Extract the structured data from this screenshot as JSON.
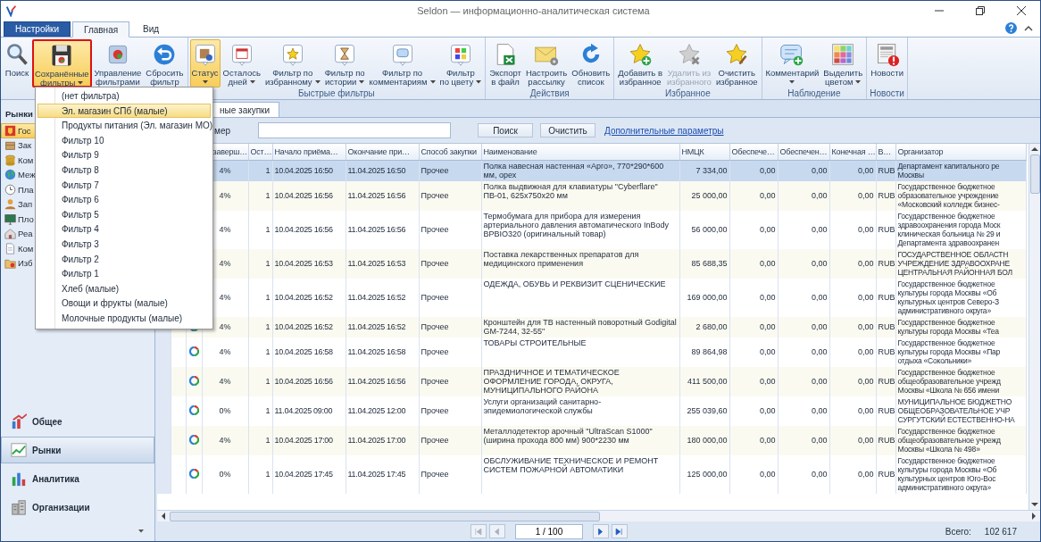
{
  "window": {
    "title": "Seldon — информационно-аналитическая система"
  },
  "ribbon_tabs": [
    {
      "label": "Настройки",
      "kind": "app",
      "selected": false
    },
    {
      "label": "Главная",
      "kind": "tab",
      "selected": true
    },
    {
      "label": "Вид",
      "kind": "tab",
      "selected": false
    }
  ],
  "ribbon_groups": [
    {
      "buttons": [
        {
          "label": "Поиск",
          "dropdown": false,
          "open": false,
          "pressed": false,
          "disabled": false
        },
        {
          "label": "Сохранённые\nфильтры",
          "dropdown": true,
          "open": true,
          "pressed": false,
          "disabled": false
        },
        {
          "label": "Управление\nфильтрами",
          "dropdown": false,
          "open": false,
          "pressed": false,
          "disabled": false
        },
        {
          "label": "Сбросить\nфильтр",
          "dropdown": false,
          "open": false,
          "pressed": false,
          "disabled": false
        }
      ]
    },
    {
      "label": "Быстрые фильтры",
      "buttons": [
        {
          "label": "Статус",
          "dropdown": true,
          "open": false,
          "pressed": true,
          "disabled": false
        },
        {
          "label": "Осталось\nдней",
          "dropdown": true,
          "open": false,
          "pressed": false,
          "disabled": false
        },
        {
          "label": "Фильтр по\nизбранному",
          "dropdown": true,
          "open": false,
          "pressed": false,
          "disabled": false
        },
        {
          "label": "Фильтр по\nистории",
          "dropdown": true,
          "open": false,
          "pressed": false,
          "disabled": false
        },
        {
          "label": "Фильтр по\nкомментариям",
          "dropdown": true,
          "open": false,
          "pressed": false,
          "disabled": false
        },
        {
          "label": "Фильтр\nпо цвету",
          "dropdown": true,
          "open": false,
          "pressed": false,
          "disabled": false
        }
      ]
    },
    {
      "label": "Действия",
      "buttons": [
        {
          "label": "Экспорт\nв файл",
          "dropdown": false,
          "open": false,
          "pressed": false,
          "disabled": false
        },
        {
          "label": "Настроить\nрассылку",
          "dropdown": false,
          "open": false,
          "pressed": false,
          "disabled": false
        },
        {
          "label": "Обновить\nсписок",
          "dropdown": false,
          "open": false,
          "pressed": false,
          "disabled": false
        }
      ]
    },
    {
      "label": "Избранное",
      "buttons": [
        {
          "label": "Добавить в\nизбранное",
          "dropdown": false,
          "open": false,
          "pressed": false,
          "disabled": false
        },
        {
          "label": "Удалить из\nизбранного",
          "dropdown": false,
          "open": false,
          "pressed": false,
          "disabled": true
        },
        {
          "label": "Очистить\nизбранное",
          "dropdown": false,
          "open": false,
          "pressed": false,
          "disabled": false
        }
      ]
    },
    {
      "label": "Наблюдение",
      "buttons": [
        {
          "label": "Комментарий",
          "dropdown": true,
          "open": false,
          "pressed": false,
          "disabled": false
        },
        {
          "label": "Выделить\nцветом",
          "dropdown": true,
          "open": false,
          "pressed": false,
          "disabled": false
        }
      ]
    },
    {
      "label": "Новости",
      "buttons": [
        {
          "label": "Новости",
          "dropdown": false,
          "open": false,
          "pressed": false,
          "disabled": false
        }
      ]
    }
  ],
  "saved_filters_menu": {
    "items": [
      {
        "label": "(нет фильтра)",
        "selected": false
      },
      {
        "label": "Эл. магазин СПб (малые)",
        "selected": true
      },
      {
        "label": "Продукты питания (Эл. магазин МО)",
        "selected": false
      },
      {
        "label": "Фильтр 10",
        "selected": false
      },
      {
        "label": "Фильтр 9",
        "selected": false
      },
      {
        "label": "Фильтр 8",
        "selected": false
      },
      {
        "label": "Фильтр 7",
        "selected": false
      },
      {
        "label": "Фильтр 6",
        "selected": false
      },
      {
        "label": "Фильтр 5",
        "selected": false
      },
      {
        "label": "Фильтр 4",
        "selected": false
      },
      {
        "label": "Фильтр 3",
        "selected": false
      },
      {
        "label": "Фильтр 2",
        "selected": false
      },
      {
        "label": "Фильтр 1",
        "selected": false
      },
      {
        "label": "Хлеб (малые)",
        "selected": false
      },
      {
        "label": "Овощи и фрукты (малые)",
        "selected": false
      },
      {
        "label": "Молочные продукты (малые)",
        "selected": false
      }
    ]
  },
  "sidebar": {
    "title": "Рынки",
    "items": [
      {
        "label": "Гос",
        "selected": true
      },
      {
        "label": "Зак",
        "selected": false
      },
      {
        "label": "Ком",
        "selected": false
      },
      {
        "label": "Меж",
        "selected": false
      },
      {
        "label": "Пла",
        "selected": false
      },
      {
        "label": "Зап",
        "selected": false
      },
      {
        "label": "Пло",
        "selected": false
      },
      {
        "label": "Реа",
        "selected": false
      },
      {
        "label": "Ком",
        "selected": false
      },
      {
        "label": "Изб",
        "selected": false
      }
    ],
    "nav": [
      {
        "label": "Общее",
        "selected": false
      },
      {
        "label": "Рынки",
        "selected": true
      },
      {
        "label": "Аналитика",
        "selected": false
      },
      {
        "label": "Организации",
        "selected": false
      }
    ]
  },
  "doc_tabs": [
    {
      "label": "ные закупки",
      "selected": true
    }
  ],
  "search": {
    "label": "мер",
    "buttons": [
      "Поиск",
      "Очистить"
    ],
    "link": "Дополнительные параметры"
  },
  "table": {
    "columns": [
      "заверш…",
      "Ост…",
      "Начало приёма…",
      "Окончание при…",
      "Способ закупки",
      "Наименование",
      "НМЦК",
      "Обеспече…",
      "Обеспечен…",
      "Конечная …",
      "В…",
      "Организатор"
    ],
    "rows": [
      {
        "selected": true,
        "cells": [
          "4%",
          "1",
          "10.04.2025 16:50",
          "11.04.2025 16:50",
          "Прочее",
          "Полка навесная настенная «Арго», 770*290*600 мм, орех",
          "7 334,00",
          "0,00",
          "0,00",
          "0,00",
          "RUB",
          "Департамент капитального ре\nМосквы"
        ]
      },
      {
        "selected": false,
        "cells": [
          "4%",
          "1",
          "10.04.2025 16:56",
          "11.04.2025 16:56",
          "Прочее",
          "Полка выдвижная для клавиатуры \"Cyberflare\" ПВ-01, 625x750x20 мм",
          "25 000,00",
          "0,00",
          "0,00",
          "0,00",
          "RUB",
          "Государственное бюджетное\nобразовательное учреждение\n«Московский колледж бизнес-"
        ]
      },
      {
        "selected": false,
        "cells": [
          "4%",
          "1",
          "10.04.2025 16:56",
          "11.04.2025 16:56",
          "Прочее",
          "Термобумага для прибора для измерения артериального давления автоматического InBody BPBIO320 (оригинальный товар)",
          "56 000,00",
          "0,00",
          "0,00",
          "0,00",
          "RUB",
          "Государственное бюджетное\nздравоохранения города Моск\nклиническая больница № 29 и\nДепартамента здравоохранен"
        ]
      },
      {
        "selected": false,
        "cells": [
          "4%",
          "1",
          "10.04.2025 16:53",
          "11.04.2025 16:53",
          "Прочее",
          "Поставка лекарственных препаратов для медицинского применения",
          "85 688,35",
          "0,00",
          "0,00",
          "0,00",
          "RUB",
          "ГОСУДАРСТВЕННОЕ ОБЛАСТН\nУЧРЕЖДЕНИЕ ЗДРАВООХРАНЕ\nЦЕНТРАЛЬНАЯ РАЙОННАЯ БОЛ"
        ]
      },
      {
        "selected": false,
        "cells": [
          "4%",
          "1",
          "10.04.2025 16:52",
          "11.04.2025 16:52",
          "Прочее",
          "ОДЕЖДА, ОБУВЬ И РЕКВИЗИТ СЦЕНИЧЕСКИЕ",
          "169 000,00",
          "0,00",
          "0,00",
          "0,00",
          "RUB",
          "Государственное бюджетное\nкультуры города Москвы «Об\nкультурных центров Северо-З\nадминистративного округа»"
        ]
      },
      {
        "selected": false,
        "icon": true,
        "cells": [
          "4%",
          "1",
          "10.04.2025 16:52",
          "11.04.2025 16:52",
          "Прочее",
          "Кронштейн для ТВ настенный поворотный Godigital GM-7244, 32-55\"",
          "2 680,00",
          "0,00",
          "0,00",
          "0,00",
          "RUB",
          "Государственное бюджетное\nкультуры города Москвы «Теа"
        ]
      },
      {
        "selected": false,
        "icon": true,
        "cells": [
          "4%",
          "1",
          "10.04.2025 16:58",
          "11.04.2025 16:58",
          "Прочее",
          "ТОВАРЫ СТРОИТЕЛЬНЫЕ",
          "89 864,98",
          "0,00",
          "0,00",
          "0,00",
          "RUB",
          "Государственное бюджетное\nкультуры города Москвы «Пар\nотдыха «Сокольники»"
        ]
      },
      {
        "selected": false,
        "icon": true,
        "cells": [
          "4%",
          "1",
          "10.04.2025 16:56",
          "11.04.2025 16:56",
          "Прочее",
          "ПРАЗДНИЧНОЕ И ТЕМАТИЧЕСКОЕ ОФОРМЛЕНИЕ ГОРОДА, ОКРУГА, МУНИЦИПАЛЬНОГО РАЙОНА",
          "411 500,00",
          "0,00",
          "0,00",
          "0,00",
          "RUB",
          "Государственное бюджетное\nобщеобразовательное учрежд\nМосквы «Школа № 656 имени"
        ]
      },
      {
        "selected": false,
        "icon": true,
        "cells": [
          "0%",
          "1",
          "11.04.2025 09:00",
          "11.04.2025 12:00",
          "Прочее",
          "Услуги организаций санитарно-эпидемиологической службы",
          "255 039,60",
          "0,00",
          "0,00",
          "0,00",
          "RUB",
          "МУНИЦИПАЛЬНОЕ БЮДЖЕТНО\nОБЩЕОБРАЗОВАТЕЛЬНОЕ УЧР\nСУРГУТСКИЙ ЕСТЕСТВЕННО-НА"
        ]
      },
      {
        "selected": false,
        "icon": true,
        "cells": [
          "4%",
          "1",
          "10.04.2025 17:00",
          "11.04.2025 17:00",
          "Прочее",
          "Металлодетектор арочный \"UltraScan S1000\" (ширина прохода 800 мм) 900*2230 мм",
          "180 000,00",
          "0,00",
          "0,00",
          "0,00",
          "RUB",
          "Государственное бюджетное\nобщеобразовательное учрежд\nМосквы «Школа № 498»"
        ]
      },
      {
        "selected": false,
        "icon": true,
        "cells": [
          "0%",
          "1",
          "10.04.2025 17:45",
          "11.04.2025 17:45",
          "Прочее",
          "ОБСЛУЖИВАНИЕ ТЕХНИЧЕСКОЕ И РЕМОНТ СИСТЕМ ПОЖАРНОЙ АВТОМАТИКИ",
          "125 000,00",
          "0,00",
          "0,00",
          "0,00",
          "RUB",
          "Государственное бюджетное\nкультуры города Москвы «Об\nкультурных центров Юго-Вос\nадминистративного округа»"
        ]
      }
    ]
  },
  "pager": {
    "buttons": [
      {
        "disabled": true
      },
      {
        "disabled": true
      },
      {
        "disabled": false
      },
      {
        "disabled": false
      }
    ],
    "page": "1 / 100",
    "total_label": "Всего:",
    "total": "102 617"
  }
}
